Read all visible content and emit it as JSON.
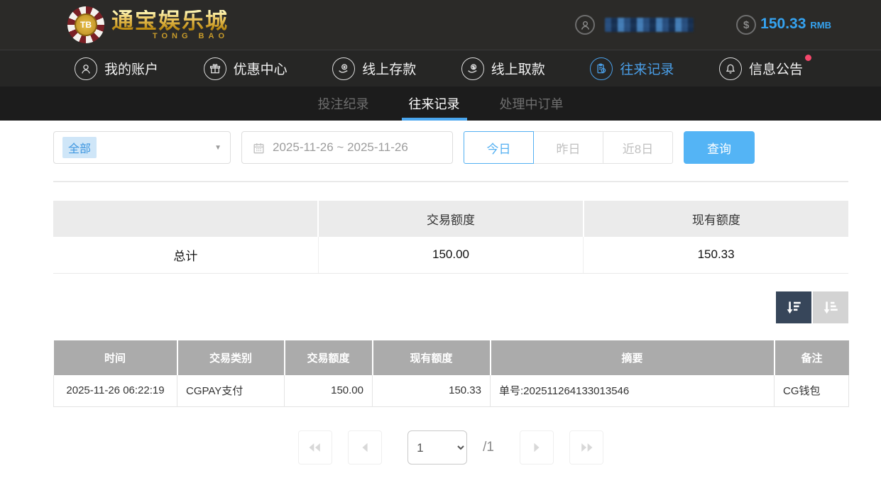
{
  "header": {
    "logo": {
      "chip_text": "TB",
      "title": "通宝娱乐城",
      "subtitle": "TONG BAO"
    },
    "balance": {
      "amount": "150.33",
      "currency": "RMB",
      "coin_symbol": "$"
    }
  },
  "nav": {
    "items": [
      {
        "label": "我的账户",
        "icon": "user"
      },
      {
        "label": "优惠中心",
        "icon": "gift"
      },
      {
        "label": "线上存款",
        "icon": "deposit-coin"
      },
      {
        "label": "线上取款",
        "icon": "withdraw-coin"
      },
      {
        "label": "往来记录",
        "icon": "records-clipboard",
        "active": true
      },
      {
        "label": "信息公告",
        "icon": "bell",
        "badge": true
      }
    ]
  },
  "tabs": [
    {
      "label": "投注纪录",
      "active": false
    },
    {
      "label": "往来记录",
      "active": true
    },
    {
      "label": "处理中订单",
      "active": false
    }
  ],
  "filters": {
    "type_select": {
      "value": "全部"
    },
    "date_range": "2025-11-26 ~ 2025-11-26",
    "quick_buttons": [
      "今日",
      "昨日",
      "近8日"
    ],
    "active_quick": "今日",
    "search_label": "查询"
  },
  "summary_table": {
    "headers": [
      "",
      "交易额度",
      "现有额度"
    ],
    "row": {
      "label": "总计",
      "values": [
        "150.00",
        "150.33"
      ]
    }
  },
  "records_table": {
    "headers": [
      "时间",
      "交易类别",
      "交易额度",
      "现有额度",
      "摘要",
      "备注"
    ],
    "rows": [
      [
        "2025-11-26 06:22:19",
        "CGPAY支付",
        "150.00",
        "150.33",
        "单号:202511264133013546",
        "CG钱包"
      ]
    ]
  },
  "pagination": {
    "current_page": "1",
    "total_label": "/1"
  },
  "colors": {
    "topbar_bg": "#2b2a28",
    "nav_bg": "#262625",
    "tab_bg": "#1c1c1c",
    "accent_blue": "#54b4f5",
    "nav_active_blue": "#4a9fe8",
    "balance_blue": "#35a3f1",
    "notification_red": "#f5476b",
    "summary_header_bg": "#ebebeb",
    "table_header_bg": "#ababab",
    "sort_active_bg": "#37465a",
    "sort_inactive_bg": "#d3d3d3",
    "gold": "#e8c054"
  }
}
